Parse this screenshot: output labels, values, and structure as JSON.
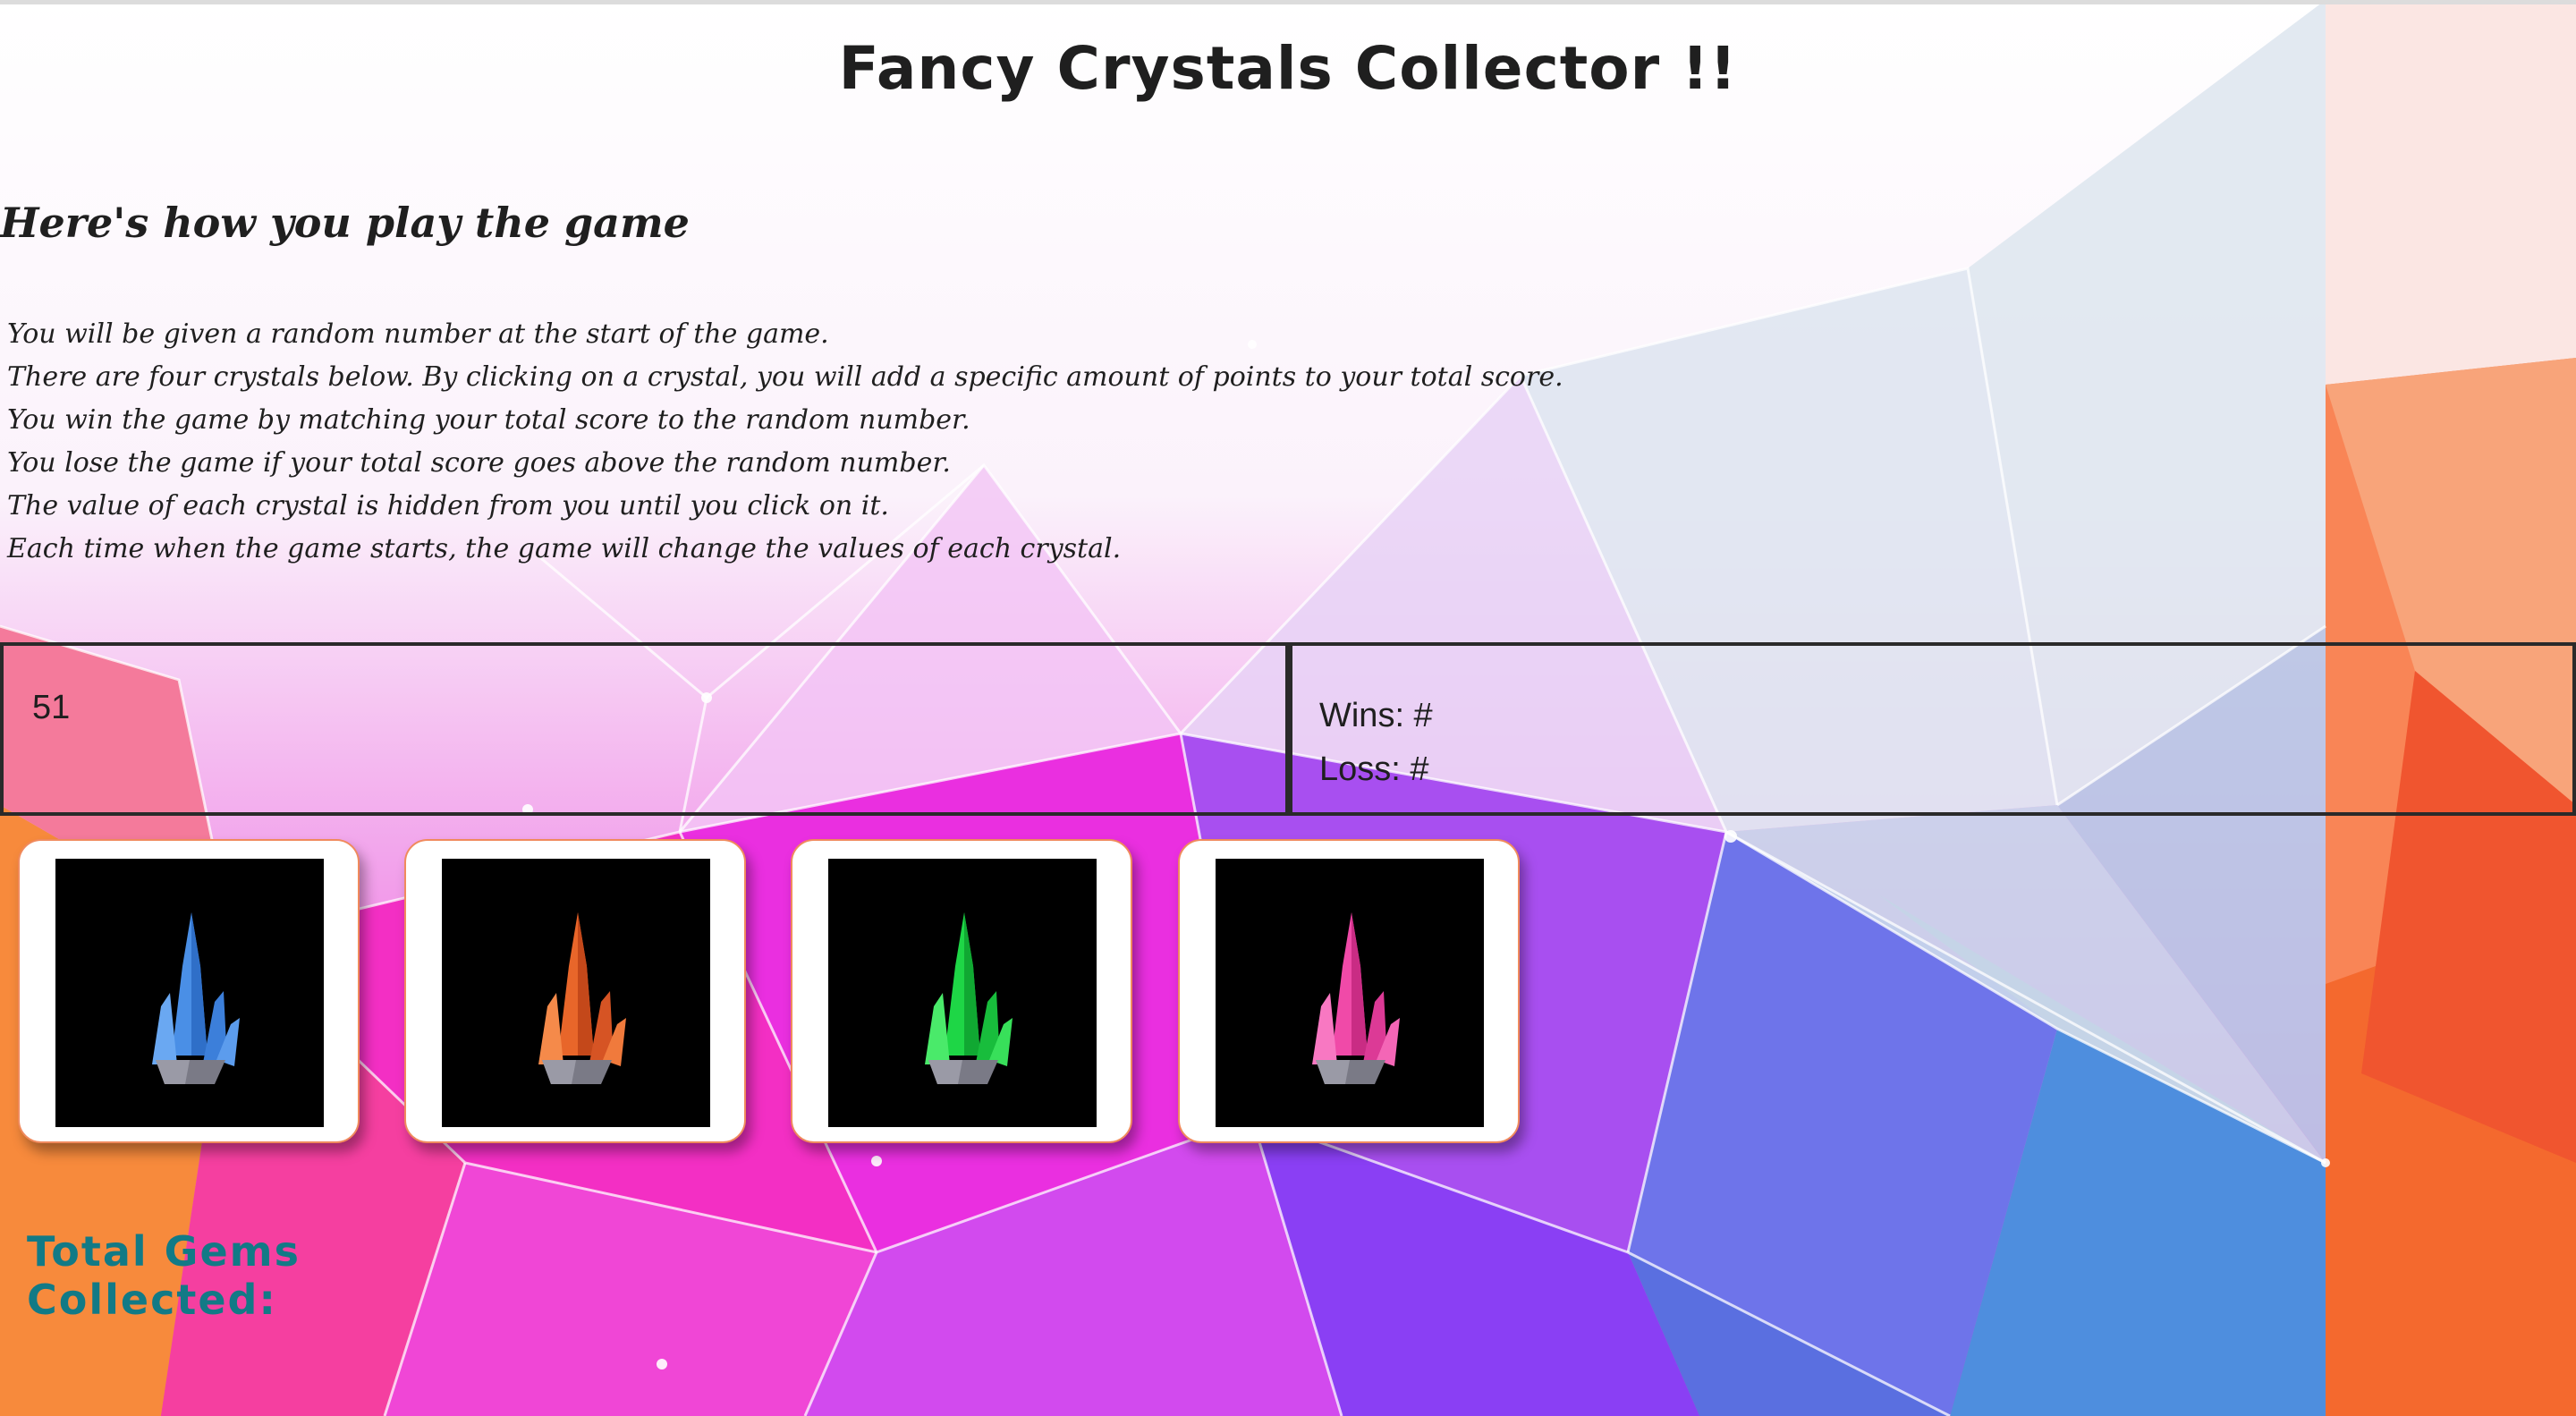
{
  "page": {
    "title": "Fancy Crystals Collector !!",
    "instructions_heading": "Here's how you play the game",
    "rules": [
      "You will be given a random number at the start of the game.",
      "There are four crystals below. By clicking on a crystal, you will add a specific amount of points to your total score.",
      "You win the game by matching your total score to the random number.",
      "You lose the game if your total score goes above the random number.",
      "The value of each crystal is hidden from you until you click on it.",
      "Each time when the game starts, the game will change the values of each crystal."
    ]
  },
  "scoreboard": {
    "target_number": "51",
    "wins_label": "Wins: #",
    "loss_label": "Loss: #"
  },
  "crystals": [
    {
      "icon": "blue-crystal-icon",
      "color": "#4a8fe6"
    },
    {
      "icon": "orange-crystal-icon",
      "color": "#e8662a"
    },
    {
      "icon": "green-crystal-icon",
      "color": "#1ed646"
    },
    {
      "icon": "pink-crystal-icon",
      "color": "#f04aa8"
    }
  ],
  "total": {
    "label": "Total Gems Collected:",
    "color": "#127a86"
  }
}
